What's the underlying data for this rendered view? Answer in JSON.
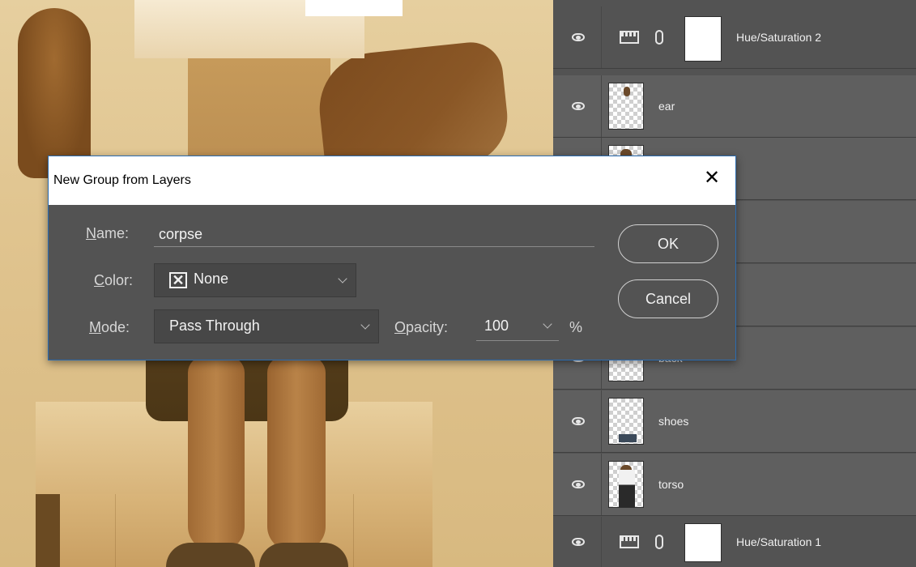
{
  "dialog": {
    "title": "New Group from Layers",
    "name_label_accel": "N",
    "name_label_rest": "ame:",
    "name_value": "corpse",
    "color_label_accel": "C",
    "color_label_rest": "olor:",
    "color_value": "None",
    "mode_label_accel": "M",
    "mode_label_rest": "ode:",
    "mode_value": "Pass Through",
    "opacity_label_accel": "O",
    "opacity_label_rest": "pacity:",
    "opacity_value": "100",
    "opacity_unit": "%",
    "ok_label": "OK",
    "cancel_label": "Cancel"
  },
  "layers": [
    {
      "name": "Hue/Saturation 2",
      "type": "adjustment"
    },
    {
      "name": "ear",
      "type": "pixel"
    },
    {
      "name": "",
      "type": "pixel"
    },
    {
      "name": "",
      "type": "pixel"
    },
    {
      "name": "",
      "type": "pixel"
    },
    {
      "name": "back",
      "type": "pixel"
    },
    {
      "name": "shoes",
      "type": "pixel"
    },
    {
      "name": "torso",
      "type": "pixel"
    },
    {
      "name": "Hue/Saturation 1",
      "type": "adjustment"
    }
  ],
  "colors": {
    "dialog_bg": "#535353",
    "dialog_border": "#2b6cb0",
    "panel_bg": "#535353",
    "canvas_tone": "#e0c48f"
  }
}
